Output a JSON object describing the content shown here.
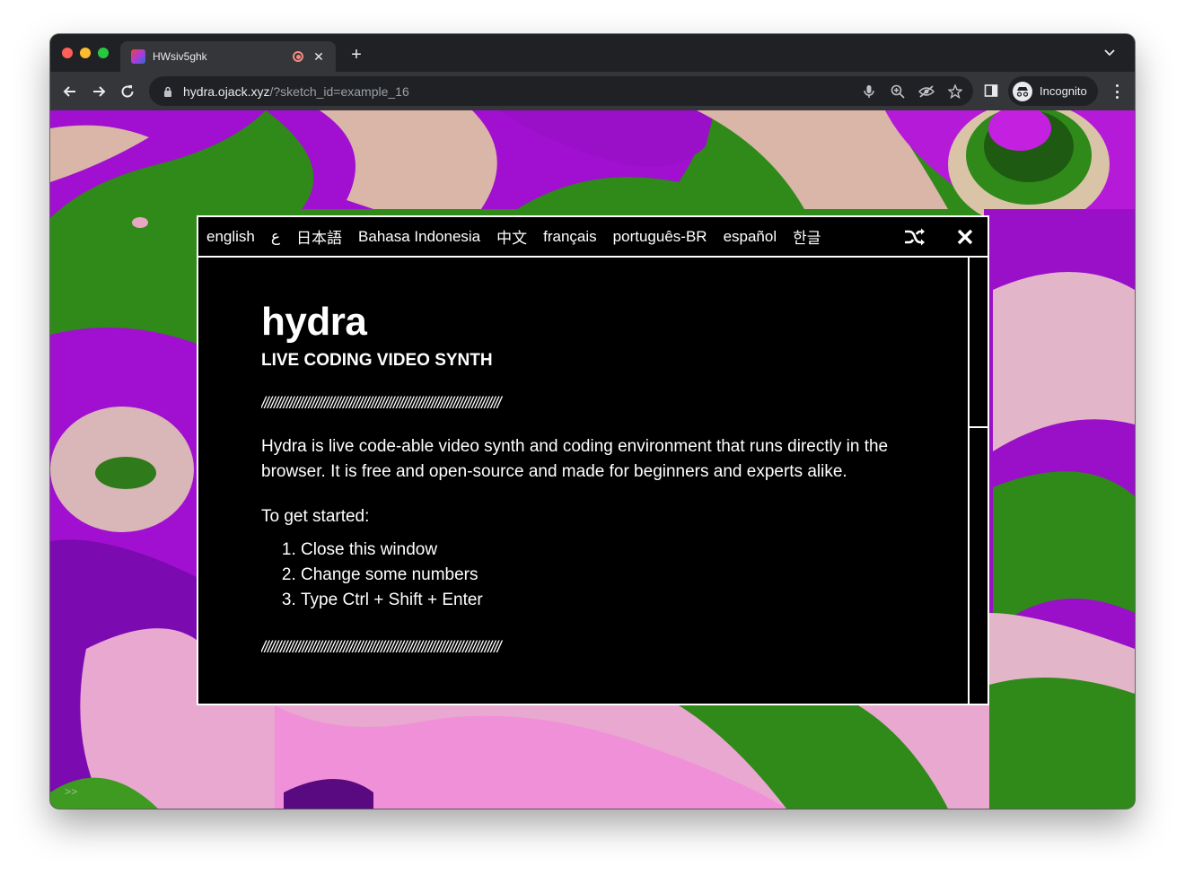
{
  "browser": {
    "tab_title": "HWsiv5ghk",
    "new_tab_label": "+",
    "tab_close_label": "✕",
    "tab_menu_label": "⌄",
    "url_host": "hydra.ojack.xyz",
    "url_path": "/?sketch_id=example_16",
    "profile_label": "Incognito"
  },
  "modal": {
    "languages": [
      "english",
      "ع",
      "日本語",
      "Bahasa Indonesia",
      "中文",
      "français",
      "português-BR",
      "español",
      "한글"
    ],
    "title": "hydra",
    "subtitle": "LIVE CODING VIDEO SYNTH",
    "divider": "////////////////////////////////////////////////////////////////////////////",
    "intro": "Hydra is live code-able video synth and coding environment that runs directly in the browser. It is free and open-source and made for beginners and experts alike.",
    "started_label": "To get started:",
    "steps": [
      "Close this window",
      "Change some numbers",
      "Type Ctrl + Shift + Enter"
    ]
  },
  "editor": {
    "prompt_hint": ">>"
  },
  "colors": {
    "green": "#2f8a1a",
    "purple": "#9a0fc8",
    "pink": "#e8a8d0",
    "beige": "#d8c0a8"
  }
}
